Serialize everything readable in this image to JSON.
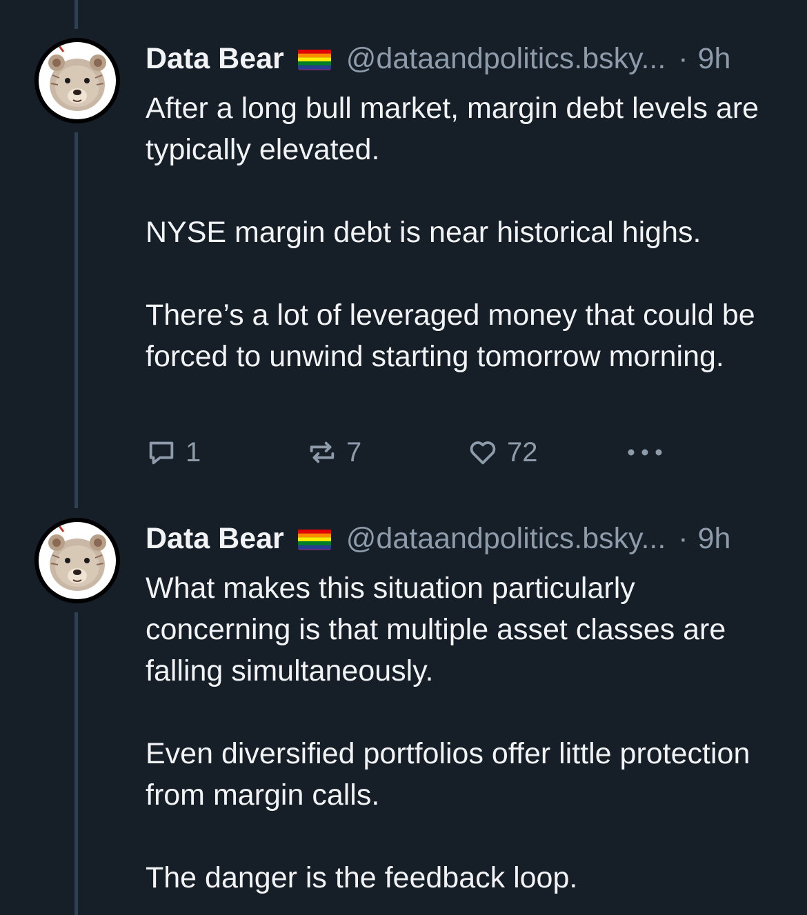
{
  "posts": [
    {
      "display_name": "Data Bear",
      "flag_icon": "rainbow-flag-icon",
      "handle": "@dataandpolitics.bsky...",
      "separator": "·",
      "time": "9h",
      "paragraphs": [
        "After a long bull market, margin debt levels are typically elevated.",
        "NYSE margin debt is near historical highs.",
        "There’s a lot of leveraged money that could be forced to unwind starting tomorrow morning."
      ],
      "actions": {
        "reply_count": "1",
        "repost_count": "7",
        "like_count": "72"
      }
    },
    {
      "display_name": "Data Bear",
      "flag_icon": "rainbow-flag-icon",
      "handle": "@dataandpolitics.bsky...",
      "separator": "·",
      "time": "9h",
      "paragraphs": [
        "What makes this situation particularly concerning is that multiple asset classes are falling simultaneously.",
        "Even diversified portfolios offer little protection from margin calls.",
        "The danger is the feedback loop."
      ]
    }
  ],
  "colors": {
    "background": "#161e27",
    "text_primary": "#f1f3f5",
    "text_secondary": "#8d9bab",
    "thread_line": "#2e4052",
    "flag_stripes": [
      "#e40303",
      "#ff8c00",
      "#ffed00",
      "#008026",
      "#24408e",
      "#732982"
    ]
  }
}
